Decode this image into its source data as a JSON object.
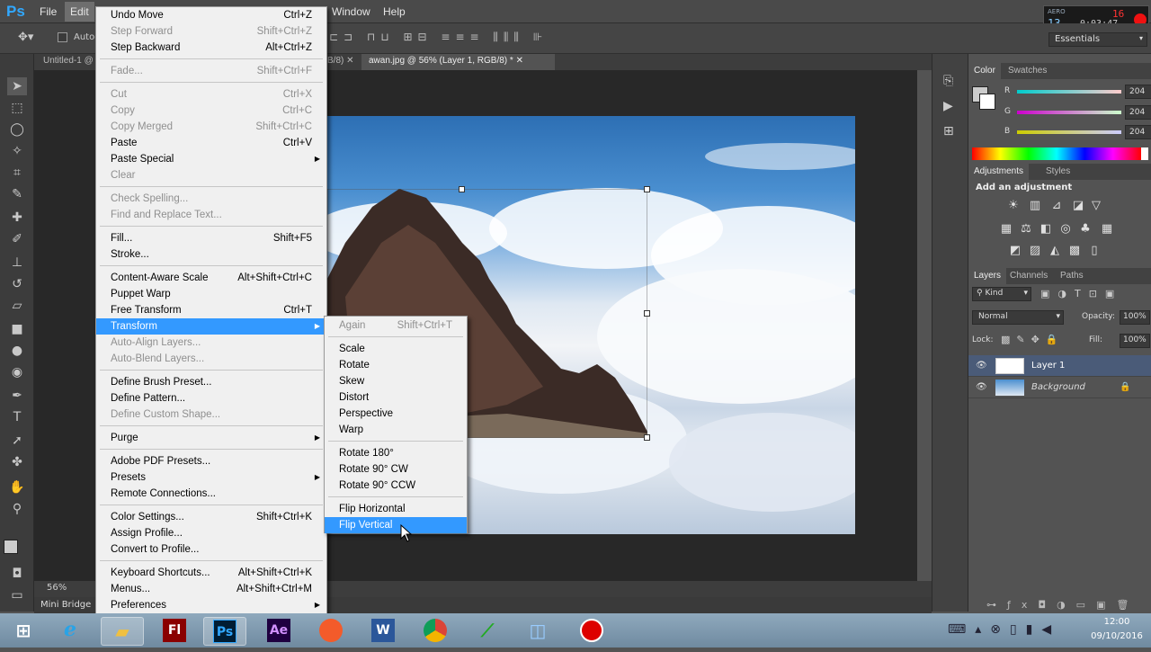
{
  "app": {
    "logo": "Ps",
    "menubar": [
      "File",
      "Edit",
      "Window",
      "Help"
    ],
    "workspace": "Essentials",
    "options_auto": "Auto-"
  },
  "recorder": {
    "top": "AERO",
    "red_num": "16",
    "num": "13",
    "time": "0:03:47"
  },
  "tabs": [
    {
      "label": "Untitled-1 @"
    },
    {
      "label": "B/8)"
    },
    {
      "label": "awan.jpg @ 56% (Layer 1, RGB/8) *"
    }
  ],
  "status": {
    "zoom": "56%"
  },
  "minibridge": "Mini Bridge",
  "edit_menu": [
    {
      "label": "Undo Move",
      "shortcut": "Ctrl+Z",
      "disabled": false
    },
    {
      "label": "Step Forward",
      "shortcut": "Shift+Ctrl+Z",
      "disabled": true
    },
    {
      "label": "Step Backward",
      "shortcut": "Alt+Ctrl+Z",
      "disabled": false
    },
    {
      "label": "Fade...",
      "shortcut": "Shift+Ctrl+F",
      "disabled": true
    },
    {
      "label": "Cut",
      "shortcut": "Ctrl+X",
      "disabled": true
    },
    {
      "label": "Copy",
      "shortcut": "Ctrl+C",
      "disabled": true
    },
    {
      "label": "Copy Merged",
      "shortcut": "Shift+Ctrl+C",
      "disabled": true
    },
    {
      "label": "Paste",
      "shortcut": "Ctrl+V",
      "disabled": false
    },
    {
      "label": "Paste Special",
      "shortcut": "",
      "disabled": false,
      "submenu": true
    },
    {
      "label": "Clear",
      "shortcut": "",
      "disabled": true
    },
    {
      "label": "Check Spelling...",
      "shortcut": "",
      "disabled": true
    },
    {
      "label": "Find and Replace Text...",
      "shortcut": "",
      "disabled": true
    },
    {
      "label": "Fill...",
      "shortcut": "Shift+F5",
      "disabled": false
    },
    {
      "label": "Stroke...",
      "shortcut": "",
      "disabled": false
    },
    {
      "label": "Content-Aware Scale",
      "shortcut": "Alt+Shift+Ctrl+C",
      "disabled": false
    },
    {
      "label": "Puppet Warp",
      "shortcut": "",
      "disabled": false
    },
    {
      "label": "Free Transform",
      "shortcut": "Ctrl+T",
      "disabled": false
    },
    {
      "label": "Transform",
      "shortcut": "",
      "disabled": false,
      "submenu": true,
      "highlighted": true
    },
    {
      "label": "Auto-Align Layers...",
      "shortcut": "",
      "disabled": true
    },
    {
      "label": "Auto-Blend Layers...",
      "shortcut": "",
      "disabled": true
    },
    {
      "label": "Define Brush Preset...",
      "shortcut": "",
      "disabled": false
    },
    {
      "label": "Define Pattern...",
      "shortcut": "",
      "disabled": false
    },
    {
      "label": "Define Custom Shape...",
      "shortcut": "",
      "disabled": true
    },
    {
      "label": "Purge",
      "shortcut": "",
      "disabled": false,
      "submenu": true
    },
    {
      "label": "Adobe PDF Presets...",
      "shortcut": "",
      "disabled": false
    },
    {
      "label": "Presets",
      "shortcut": "",
      "disabled": false,
      "submenu": true
    },
    {
      "label": "Remote Connections...",
      "shortcut": "",
      "disabled": false
    },
    {
      "label": "Color Settings...",
      "shortcut": "Shift+Ctrl+K",
      "disabled": false
    },
    {
      "label": "Assign Profile...",
      "shortcut": "",
      "disabled": false
    },
    {
      "label": "Convert to Profile...",
      "shortcut": "",
      "disabled": false
    },
    {
      "label": "Keyboard Shortcuts...",
      "shortcut": "Alt+Shift+Ctrl+K",
      "disabled": false
    },
    {
      "label": "Menus...",
      "shortcut": "Alt+Shift+Ctrl+M",
      "disabled": false
    },
    {
      "label": "Preferences",
      "shortcut": "",
      "disabled": false,
      "submenu": true
    }
  ],
  "transform_menu": [
    {
      "label": "Again",
      "shortcut": "Shift+Ctrl+T",
      "disabled": true
    },
    {
      "label": "Scale",
      "shortcut": "",
      "disabled": false
    },
    {
      "label": "Rotate",
      "shortcut": "",
      "disabled": false
    },
    {
      "label": "Skew",
      "shortcut": "",
      "disabled": false
    },
    {
      "label": "Distort",
      "shortcut": "",
      "disabled": false
    },
    {
      "label": "Perspective",
      "shortcut": "",
      "disabled": false
    },
    {
      "label": "Warp",
      "shortcut": "",
      "disabled": false
    },
    {
      "label": "Rotate 180°",
      "shortcut": "",
      "disabled": false
    },
    {
      "label": "Rotate 90° CW",
      "shortcut": "",
      "disabled": false
    },
    {
      "label": "Rotate 90° CCW",
      "shortcut": "",
      "disabled": false
    },
    {
      "label": "Flip Horizontal",
      "shortcut": "",
      "disabled": false
    },
    {
      "label": "Flip Vertical",
      "shortcut": "",
      "disabled": false,
      "highlighted": true
    }
  ],
  "color_panel": {
    "tabs": [
      "Color",
      "Swatches"
    ],
    "r_label": "R",
    "g_label": "G",
    "b_label": "B",
    "r": "204",
    "g": "204",
    "b": "204"
  },
  "adjustments_panel": {
    "tabs": [
      "Adjustments",
      "Styles"
    ],
    "heading": "Add an adjustment"
  },
  "layers_panel": {
    "tabs": [
      "Layers",
      "Channels",
      "Paths"
    ],
    "filter": "Kind",
    "blend_mode": "Normal",
    "opacity_label": "Opacity:",
    "opacity": "100%",
    "lock_label": "Lock:",
    "fill_label": "Fill:",
    "fill": "100%",
    "layers": [
      {
        "name": "Layer 1",
        "selected": true
      },
      {
        "name": "Background",
        "selected": false,
        "locked": true
      }
    ]
  },
  "taskbar": {
    "apps": [
      "start",
      "ie",
      "explorer",
      "flash",
      "photoshop",
      "aftereffects",
      "app7",
      "word",
      "chrome",
      "app10",
      "app11",
      "record"
    ],
    "flash_label": "Fl",
    "ps_label": "Ps",
    "ae_label": "Ae",
    "word_label": "W",
    "time": "12:00",
    "date": "09/10/2016"
  },
  "colors": {
    "highlight": "#3399ff",
    "ps_blue": "#31a8ff"
  }
}
